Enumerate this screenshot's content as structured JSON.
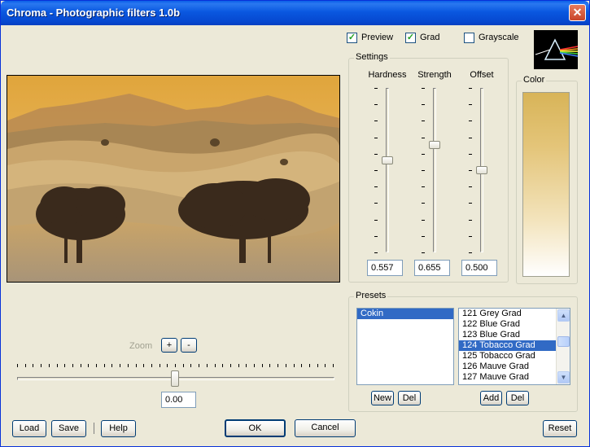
{
  "window": {
    "title": "Chroma - Photographic filters 1.0b",
    "close_glyph": "✕"
  },
  "options": {
    "preview_label": "Preview",
    "preview_checked": true,
    "grad_label": "Grad",
    "grad_checked": true,
    "grayscale_label": "Grayscale",
    "grayscale_checked": false
  },
  "settings": {
    "title": "Settings",
    "sliders": [
      {
        "label": "Hardness",
        "value": "0.557",
        "level": 0.557
      },
      {
        "label": "Strength",
        "value": "0.655",
        "level": 0.655
      },
      {
        "label": "Offset",
        "value": "0.500",
        "level": 0.5
      }
    ]
  },
  "color": {
    "title": "Color",
    "gradient_top": "#d8b458",
    "gradient_bottom": "#ffffff"
  },
  "zoom": {
    "label": "Zoom",
    "plus_label": "+",
    "minus_label": "-",
    "value": "0.00",
    "level": 0.5
  },
  "presets": {
    "title": "Presets",
    "categories": [
      "Cokin"
    ],
    "selected_category": "Cokin",
    "items": [
      "121 Grey Grad",
      "122 Blue Grad",
      "123 Blue Grad",
      "124 Tobacco Grad",
      "125 Tobacco Grad",
      "126 Mauve Grad",
      "127 Mauve Grad"
    ],
    "selected_item": "124 Tobacco Grad",
    "new_label": "New",
    "del_label": "Del",
    "add_label": "Add",
    "del2_label": "Del"
  },
  "footer": {
    "load_label": "Load",
    "save_label": "Save",
    "help_label": "Help",
    "ok_label": "OK",
    "cancel_label": "Cancel",
    "reset_label": "Reset"
  },
  "icons": {
    "logo": "prism-logo-icon",
    "close": "close-icon",
    "scroll_up": "arrow-up-icon",
    "scroll_down": "arrow-down-icon"
  }
}
